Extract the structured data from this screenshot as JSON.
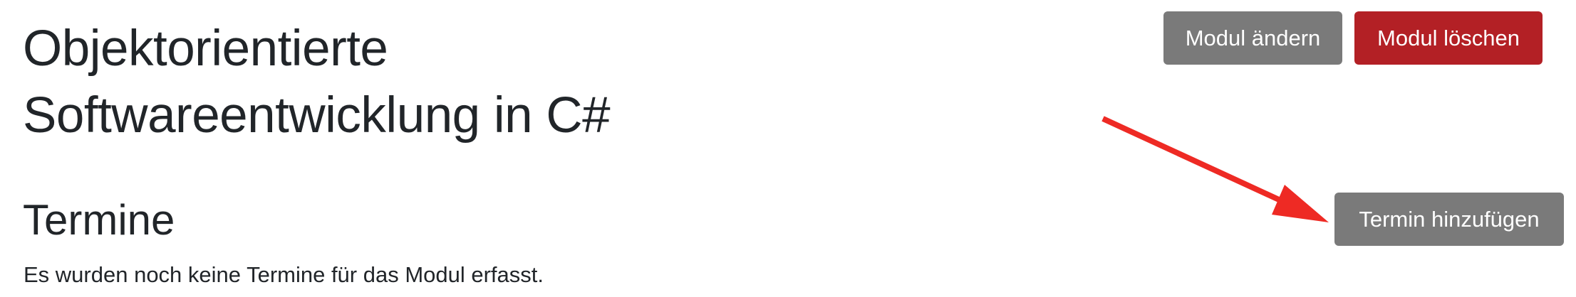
{
  "module": {
    "title": "Objektorientierte Softwareentwicklung in C#"
  },
  "actions": {
    "edit_label": "Modul ändern",
    "delete_label": "Modul löschen"
  },
  "appointments": {
    "heading": "Termine",
    "add_label": "Termin hinzufügen",
    "empty_message": "Es wurden noch keine Termine für das Modul erfasst."
  },
  "colors": {
    "secondary_button": "#7a7a7a",
    "danger_button": "#b32025",
    "annotation_arrow": "#ee2a24",
    "text": "#212529"
  },
  "icons": {
    "annotation": "red-arrow-icon"
  }
}
